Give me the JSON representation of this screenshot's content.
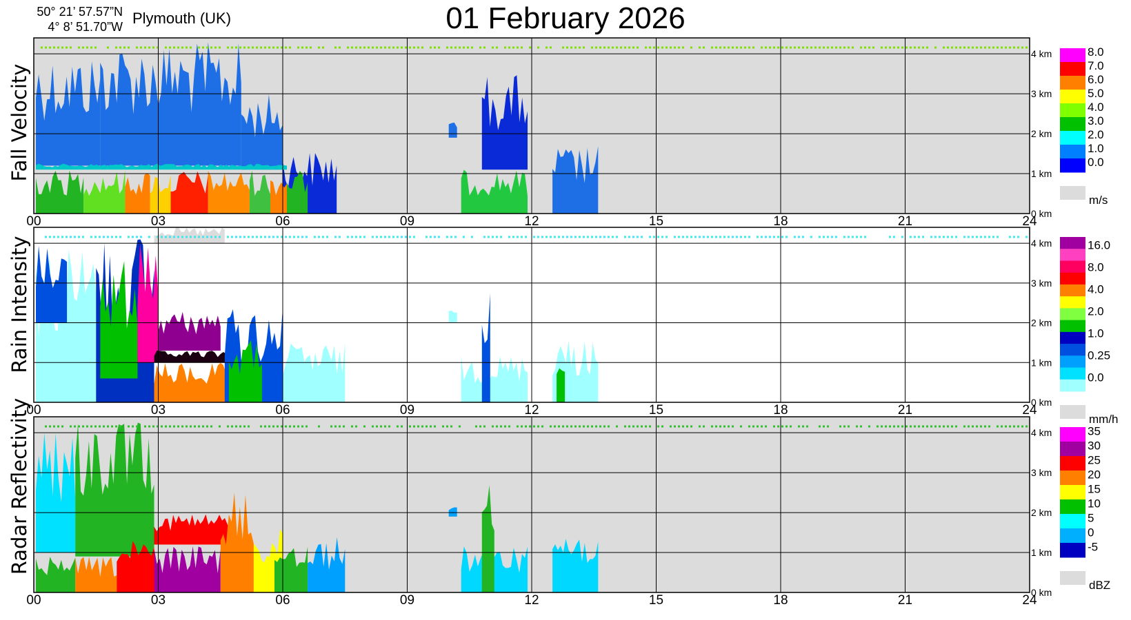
{
  "header": {
    "lat": "50° 21’ 57.57”N",
    "lon": "4°  8’ 51.70”W",
    "location": "Plymouth (UK)",
    "title": "01 February  2026"
  },
  "x_ticks": [
    "00",
    "03",
    "06",
    "09",
    "12",
    "15",
    "18",
    "21",
    "24"
  ],
  "y_ticks": [
    "0 km",
    "1 km",
    "2 km",
    "3 km",
    "4 km"
  ],
  "chart_data": [
    {
      "type": "heatmap",
      "title": "Fall Velocity",
      "xlim": [
        0,
        24
      ],
      "ylim": [
        0,
        4.4
      ],
      "background": "#dcdcdc",
      "colorbar": {
        "labels": [
          "8.0",
          "7.0",
          "6.0",
          "5.0",
          "4.0",
          "3.0",
          "2.0",
          "1.0",
          "0.0"
        ],
        "colors": [
          "#ff00ff",
          "#ff0000",
          "#ff8000",
          "#ffff00",
          "#80ff00",
          "#00c000",
          "#00ffff",
          "#0080ff",
          "#0000ff"
        ],
        "unit": "m/s",
        "nodata_color": "#dcdcdc"
      },
      "blobs": [
        {
          "x0": 0.05,
          "x1": 1.6,
          "y0": 1.2,
          "y1": 4.0,
          "c": "#1e6fe6"
        },
        {
          "x0": 1.6,
          "x1": 5.0,
          "y0": 1.2,
          "y1": 4.3,
          "c": "#1e6fe6"
        },
        {
          "x0": 5.0,
          "x1": 6.0,
          "y0": 1.1,
          "y1": 3.0,
          "c": "#1e6fe6"
        },
        {
          "x0": 6.0,
          "x1": 7.3,
          "y0": 0.0,
          "y1": 1.6,
          "c": "#0a2ad8"
        },
        {
          "x0": 0.05,
          "x1": 6.1,
          "y0": 1.1,
          "y1": 1.25,
          "c": "#00c8c8"
        },
        {
          "x0": 0.05,
          "x1": 1.2,
          "y0": 0.0,
          "y1": 1.1,
          "c": "#22b422"
        },
        {
          "x0": 1.2,
          "x1": 2.2,
          "y0": 0.0,
          "y1": 1.1,
          "c": "#60e020"
        },
        {
          "x0": 2.2,
          "x1": 2.8,
          "y0": 0.0,
          "y1": 1.1,
          "c": "#ff8000"
        },
        {
          "x0": 2.8,
          "x1": 3.3,
          "y0": 0.0,
          "y1": 1.1,
          "c": "#ffd000"
        },
        {
          "x0": 3.3,
          "x1": 4.2,
          "y0": 0.0,
          "y1": 1.1,
          "c": "#ff2000"
        },
        {
          "x0": 4.2,
          "x1": 5.2,
          "y0": 0.0,
          "y1": 1.1,
          "c": "#ff8c00"
        },
        {
          "x0": 5.2,
          "x1": 5.7,
          "y0": 0.0,
          "y1": 1.1,
          "c": "#40c040"
        },
        {
          "x0": 5.7,
          "x1": 6.1,
          "y0": 0.0,
          "y1": 1.1,
          "c": "#ff8000"
        },
        {
          "x0": 6.1,
          "x1": 6.6,
          "y0": 0.0,
          "y1": 1.1,
          "c": "#22b422"
        },
        {
          "x0": 10.3,
          "x1": 11.9,
          "y0": 0.0,
          "y1": 1.1,
          "c": "#22c840"
        },
        {
          "x0": 10.8,
          "x1": 11.9,
          "y0": 1.1,
          "y1": 3.5,
          "c": "#0a2ad8"
        },
        {
          "x0": 10.0,
          "x1": 10.2,
          "y0": 1.9,
          "y1": 2.3,
          "c": "#1e6fe6"
        },
        {
          "x0": 12.5,
          "x1": 13.6,
          "y0": 0.0,
          "y1": 1.7,
          "c": "#1e6fe6"
        }
      ],
      "dots_y": 4.15,
      "dots_color": "#80e000"
    },
    {
      "type": "heatmap",
      "title": "Rain Intensity",
      "xlim": [
        0,
        24
      ],
      "ylim": [
        0,
        4.4
      ],
      "background": "#ffffff",
      "colorbar": {
        "labels": [
          "16.0",
          "8.0",
          "4.0",
          "2.0",
          "1.0",
          "0.25",
          "0.0"
        ],
        "colors": [
          "#a000a0",
          "#ff40c0",
          "#ff0060",
          "#ff0000",
          "#ff8000",
          "#ffff00",
          "#80ff40",
          "#00c000",
          "#0000c0",
          "#0050e0",
          "#00a0ff",
          "#00e0ff",
          "#a0ffff"
        ],
        "unit": "mm/h",
        "nodata_color": "#dcdcdc"
      },
      "blobs": [
        {
          "x0": 0.05,
          "x1": 1.5,
          "y0": 0.0,
          "y1": 4.0,
          "c": "#a0ffff"
        },
        {
          "x0": 0.05,
          "x1": 0.8,
          "y0": 2.0,
          "y1": 4.0,
          "c": "#0050e0"
        },
        {
          "x0": 1.5,
          "x1": 2.9,
          "y0": 0.0,
          "y1": 4.3,
          "c": "#0030c0"
        },
        {
          "x0": 1.6,
          "x1": 2.5,
          "y0": 0.6,
          "y1": 3.6,
          "c": "#00c000"
        },
        {
          "x0": 2.9,
          "x1": 4.6,
          "y0": 4.0,
          "y1": 4.4,
          "c": "#dcdcdc"
        },
        {
          "x0": 2.9,
          "x1": 4.6,
          "y0": 0.0,
          "y1": 4.0,
          "c": "#ffffff"
        },
        {
          "x0": 2.5,
          "x1": 3.0,
          "y0": 1.0,
          "y1": 4.0,
          "c": "#ff00a0"
        },
        {
          "x0": 2.9,
          "x1": 4.7,
          "y0": 0.0,
          "y1": 1.0,
          "c": "#ff8000"
        },
        {
          "x0": 2.9,
          "x1": 4.7,
          "y0": 1.0,
          "y1": 1.3,
          "c": "#1a0010"
        },
        {
          "x0": 3.0,
          "x1": 4.5,
          "y0": 1.3,
          "y1": 2.3,
          "c": "#900090"
        },
        {
          "x0": 4.6,
          "x1": 6.0,
          "y0": 0.0,
          "y1": 2.4,
          "c": "#0050e0"
        },
        {
          "x0": 4.7,
          "x1": 5.5,
          "y0": 0.0,
          "y1": 1.6,
          "c": "#00c000"
        },
        {
          "x0": 6.0,
          "x1": 7.5,
          "y0": 0.0,
          "y1": 1.5,
          "c": "#a0ffff"
        },
        {
          "x0": 10.3,
          "x1": 11.9,
          "y0": 0.0,
          "y1": 1.2,
          "c": "#a0ffff"
        },
        {
          "x0": 10.8,
          "x1": 11.0,
          "y0": 0.0,
          "y1": 3.4,
          "c": "#0050e0"
        },
        {
          "x0": 10.0,
          "x1": 10.2,
          "y0": 2.0,
          "y1": 2.4,
          "c": "#a0ffff"
        },
        {
          "x0": 12.5,
          "x1": 13.6,
          "y0": 0.0,
          "y1": 1.6,
          "c": "#a0ffff"
        },
        {
          "x0": 12.6,
          "x1": 12.8,
          "y0": 0.0,
          "y1": 1.1,
          "c": "#00c000"
        }
      ],
      "dots_y": 4.15,
      "dots_color": "#40e8f0"
    },
    {
      "type": "heatmap",
      "title": "Radar Reflectivity",
      "xlim": [
        0,
        24
      ],
      "ylim": [
        0,
        4.4
      ],
      "background": "#dcdcdc",
      "colorbar": {
        "labels": [
          "35",
          "30",
          "25",
          "20",
          "15",
          "10",
          "5",
          "0",
          "-5"
        ],
        "colors": [
          "#ff00ff",
          "#a000a0",
          "#ff0000",
          "#ff8000",
          "#ffff00",
          "#00c000",
          "#00ffff",
          "#00b0ff",
          "#0000c0"
        ],
        "unit": "dBZ",
        "nodata_color": "#dcdcdc"
      },
      "blobs": [
        {
          "x0": 0.05,
          "x1": 1.0,
          "y0": 1.0,
          "y1": 4.0,
          "c": "#00e0ff"
        },
        {
          "x0": 0.05,
          "x1": 1.0,
          "y0": 0.0,
          "y1": 1.0,
          "c": "#22b422"
        },
        {
          "x0": 1.0,
          "x1": 2.9,
          "y0": 0.9,
          "y1": 4.3,
          "c": "#22b422"
        },
        {
          "x0": 1.0,
          "x1": 2.0,
          "y0": 0.0,
          "y1": 0.9,
          "c": "#ff8000"
        },
        {
          "x0": 2.0,
          "x1": 2.9,
          "y0": 0.0,
          "y1": 1.3,
          "c": "#ff0000"
        },
        {
          "x0": 2.9,
          "x1": 4.8,
          "y0": 2.0,
          "y1": 4.0,
          "c": "#dcdcdc"
        },
        {
          "x0": 2.9,
          "x1": 4.8,
          "y0": 1.2,
          "y1": 2.0,
          "c": "#ff0000"
        },
        {
          "x0": 2.9,
          "x1": 4.5,
          "y0": 0.0,
          "y1": 1.2,
          "c": "#a000a0"
        },
        {
          "x0": 4.5,
          "x1": 5.3,
          "y0": 0.0,
          "y1": 2.5,
          "c": "#ff8000"
        },
        {
          "x0": 5.3,
          "x1": 6.0,
          "y0": 0.0,
          "y1": 1.6,
          "c": "#ffff00"
        },
        {
          "x0": 5.8,
          "x1": 6.6,
          "y0": 0.0,
          "y1": 1.4,
          "c": "#22b422"
        },
        {
          "x0": 6.6,
          "x1": 7.5,
          "y0": 0.0,
          "y1": 1.4,
          "c": "#00a0ff"
        },
        {
          "x0": 10.3,
          "x1": 11.9,
          "y0": 0.0,
          "y1": 1.2,
          "c": "#00d8ff"
        },
        {
          "x0": 10.8,
          "x1": 11.1,
          "y0": 0.0,
          "y1": 3.4,
          "c": "#22b422"
        },
        {
          "x0": 10.0,
          "x1": 10.2,
          "y0": 1.9,
          "y1": 2.3,
          "c": "#00a0ff"
        },
        {
          "x0": 12.5,
          "x1": 13.6,
          "y0": 0.0,
          "y1": 1.6,
          "c": "#00d8ff"
        }
      ],
      "dots_y": 4.15,
      "dots_color": "#30c030"
    }
  ]
}
